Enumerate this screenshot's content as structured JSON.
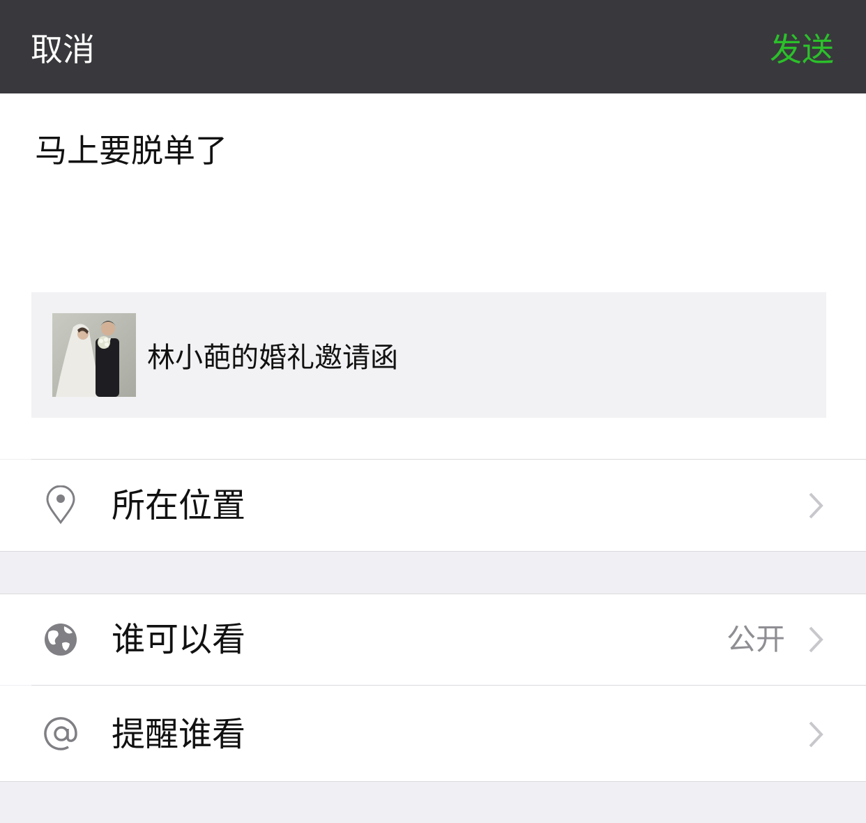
{
  "nav": {
    "cancel_label": "取消",
    "send_label": "发送"
  },
  "post": {
    "text": "马上要脱单了"
  },
  "link_card": {
    "title": "林小葩的婚礼邀请函",
    "thumbnail_icon": "wedding-photo-thumbnail"
  },
  "rows": {
    "location": {
      "label": "所在位置",
      "icon": "location-pin-icon"
    },
    "visibility": {
      "label": "谁可以看",
      "value": "公开",
      "icon": "globe-icon"
    },
    "mention": {
      "label": "提醒谁看",
      "icon": "at-sign-icon"
    }
  },
  "colors": {
    "nav_bg": "#39393d",
    "accent_green": "#2bc02a",
    "page_bg": "#efeff4",
    "card_bg": "#f2f2f4"
  }
}
